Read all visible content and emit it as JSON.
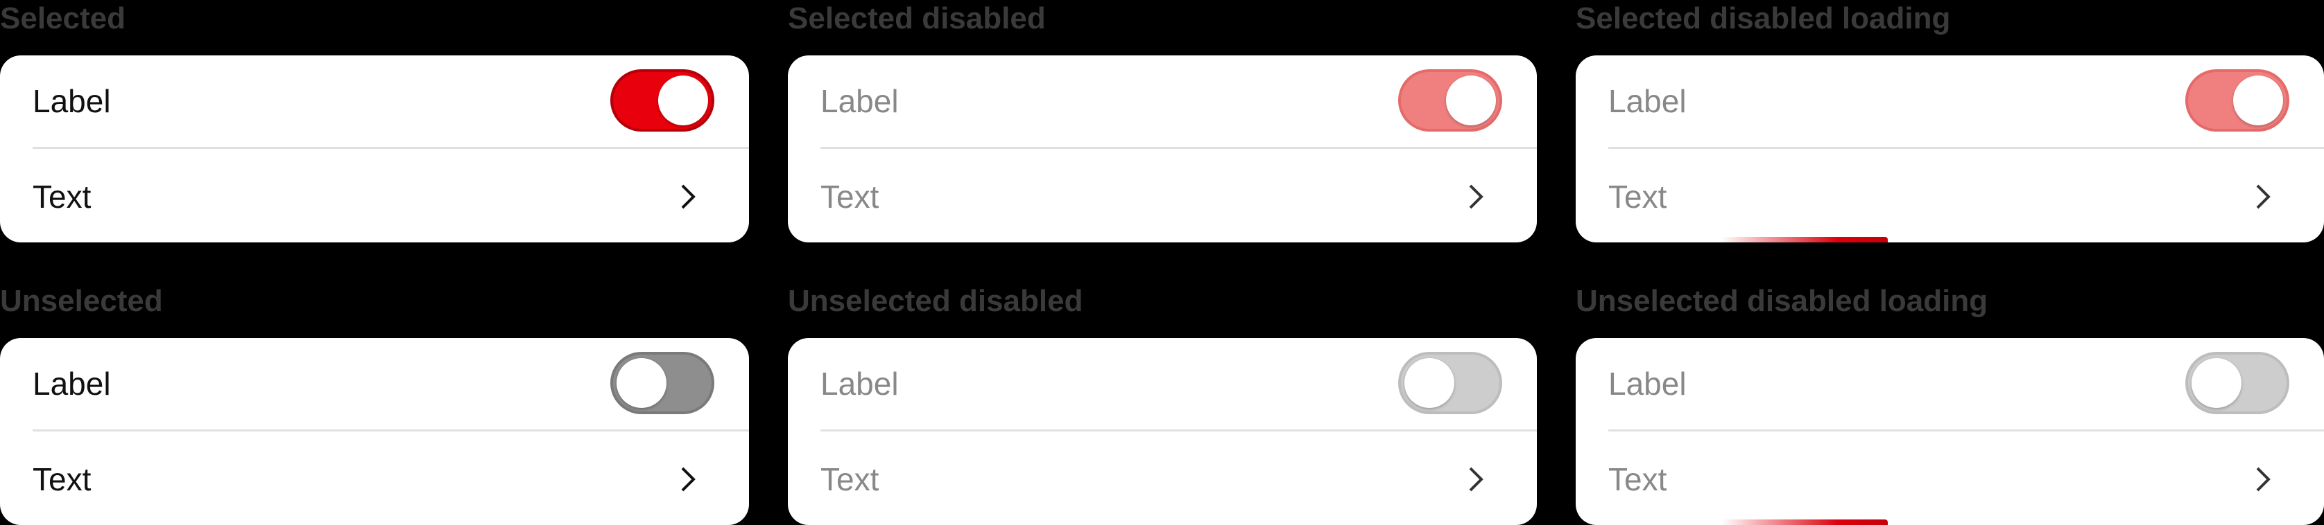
{
  "headings": {
    "selected": "Selected",
    "selected_disabled": "Selected disabled",
    "selected_disabled_loading": "Selected disabled loading",
    "unselected": "Unselected",
    "unselected_disabled": "Unselected disabled",
    "unselected_disabled_loading": "Unselected disabled loading"
  },
  "cards": {
    "selected": {
      "toggle_label": "Label",
      "nav_label": "Text",
      "toggle_on": true
    },
    "selected_disabled": {
      "toggle_label": "Label",
      "nav_label": "Text",
      "toggle_on": true
    },
    "selected_disabled_loading": {
      "toggle_label": "Label",
      "nav_label": "Text",
      "toggle_on": true
    },
    "unselected": {
      "toggle_label": "Label",
      "nav_label": "Text",
      "toggle_on": false
    },
    "unselected_disabled": {
      "toggle_label": "Label",
      "nav_label": "Text",
      "toggle_on": false
    },
    "unselected_disabled_loading": {
      "toggle_label": "Label",
      "nav_label": "Text",
      "toggle_on": false
    }
  },
  "icons": {
    "nav": "chevron-right-icon"
  },
  "colors": {
    "toggle_on": "#e8000c",
    "toggle_on_disabled": "#f08080",
    "toggle_off": "#8e8e8e",
    "toggle_off_disabled": "#cdcdcd",
    "loading_bar": "#dc000c"
  }
}
